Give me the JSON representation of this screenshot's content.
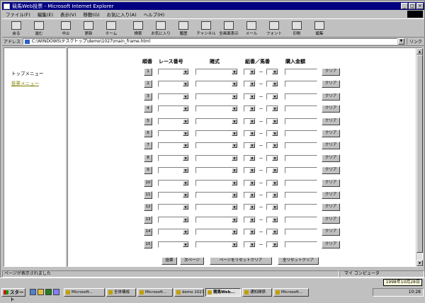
{
  "window": {
    "title": "競馬Web投票 - Microsoft Internet Explorer",
    "controls": [
      "_",
      "□",
      "×"
    ]
  },
  "menu": [
    "ファイル(F)",
    "編集(E)",
    "表示(V)",
    "移動(G)",
    "お気に入り(A)",
    "ヘルプ(H)"
  ],
  "toolbar": [
    {
      "label": "戻る",
      "icon": "back-arrow-icon"
    },
    {
      "label": "進む",
      "icon": "forward-arrow-icon"
    },
    {
      "label": "中止",
      "icon": "stop-icon"
    },
    {
      "label": "更新",
      "icon": "refresh-icon"
    },
    {
      "label": "ホーム",
      "icon": "home-icon"
    },
    {
      "label": "検索",
      "icon": "search-icon"
    },
    {
      "label": "お気に入り",
      "icon": "favorites-icon"
    },
    {
      "label": "履歴",
      "icon": "history-icon"
    },
    {
      "label": "チャンネル",
      "icon": "channels-icon"
    },
    {
      "label": "全画面表示",
      "icon": "fullscreen-icon"
    },
    {
      "label": "メール",
      "icon": "mail-icon"
    },
    {
      "label": "フォント",
      "icon": "font-icon"
    },
    {
      "label": "印刷",
      "icon": "print-icon"
    },
    {
      "label": "編集",
      "icon": "edit-icon"
    }
  ],
  "address": {
    "label": "アドレス",
    "url": "C:\\WINDOWS\\デスクトップ\\demo\\1027\\main_frame.html",
    "links_label": "リンク"
  },
  "left_menu": {
    "top_link": "トップメニュー",
    "vote_link": "投票メニュー"
  },
  "form": {
    "headers": {
      "order": "順番",
      "race": "レース番号",
      "type": "賭式",
      "kumiban": "組番／馬番",
      "amount": "購入金額"
    },
    "dash": "－",
    "clear_label": "クリア",
    "rows": [
      "1",
      "2",
      "3",
      "4",
      "5",
      "6",
      "7",
      "8",
      "9",
      "10",
      "11",
      "12",
      "13",
      "14",
      "15"
    ],
    "buttons": {
      "vote": "投票",
      "next_page": "次ページ",
      "page_reset": "ページをリセットクリア",
      "all_reset": "全リセットクリア"
    }
  },
  "status": {
    "left": "ページが表示されました",
    "zone": "マイ コンピュータ"
  },
  "taskbar": {
    "start": "スタート",
    "tasks": [
      "Microsoft...",
      "全体構成",
      "Microsoft...",
      "demo 1027",
      "競馬Web...",
      "通知関係",
      "Microsoft..."
    ],
    "clock": "10:28",
    "clock_popup": "1998年10月28日"
  },
  "colors": {
    "titlebar": "#000080",
    "face": "#c0c0c0",
    "link_visited": "#808000"
  }
}
